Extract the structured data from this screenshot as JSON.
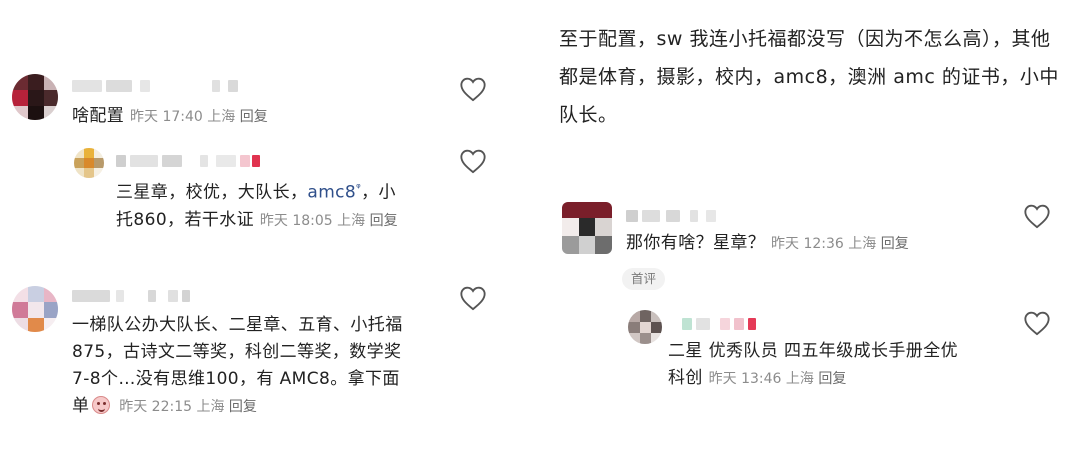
{
  "left_thread": {
    "comment1": {
      "text": "啥配置",
      "time": "昨天 17:40",
      "location": "上海",
      "reply_label": "回复",
      "like_icon": "heart-outline-icon"
    },
    "reply1": {
      "text_before": "三星章，校优，大队长，",
      "mention": "amc8",
      "mention_mark": "ᵠ",
      "text_after_line1": "，小",
      "text_line2": "托860，若干水证",
      "time": "昨天 18:05",
      "location": "上海",
      "reply_label": "回复",
      "like_icon": "heart-outline-icon"
    },
    "comment2": {
      "line1": "一梯队公办大队长、二星章、五育、小托福",
      "line2": "875，古诗文二等奖，科创二等奖，数学奖",
      "line3": "7-8个…没有思维100，有 AMC8。拿下面",
      "line4": "单",
      "emoji": "grinning-face-emoji",
      "time": "昨天 22:15",
      "location": "上海",
      "reply_label": "回复",
      "like_icon": "heart-outline-icon"
    }
  },
  "right_thread": {
    "quote_text": "至于配置，sw 我连小托福都没写（因为不怎么高），其他都是体育，摄影，校内，amc8，澳洲 amc 的证书，小中队长。",
    "comment1": {
      "text": "那你有啥？星章？",
      "time": "昨天 12:36",
      "location": "上海",
      "reply_label": "回复",
      "badge": "首评",
      "like_icon": "heart-outline-icon"
    },
    "reply1": {
      "line1": "二星 优秀队员 四五年级成长手册全优",
      "line2": "科创",
      "time": "昨天 13:46",
      "location": "上海",
      "reply_label": "回复",
      "like_icon": "heart-outline-icon"
    }
  },
  "colors": {
    "text": "#222222",
    "meta": "#8c8c8c",
    "mention": "#2f4f8a",
    "badge_bg": "#f2f2f2"
  }
}
